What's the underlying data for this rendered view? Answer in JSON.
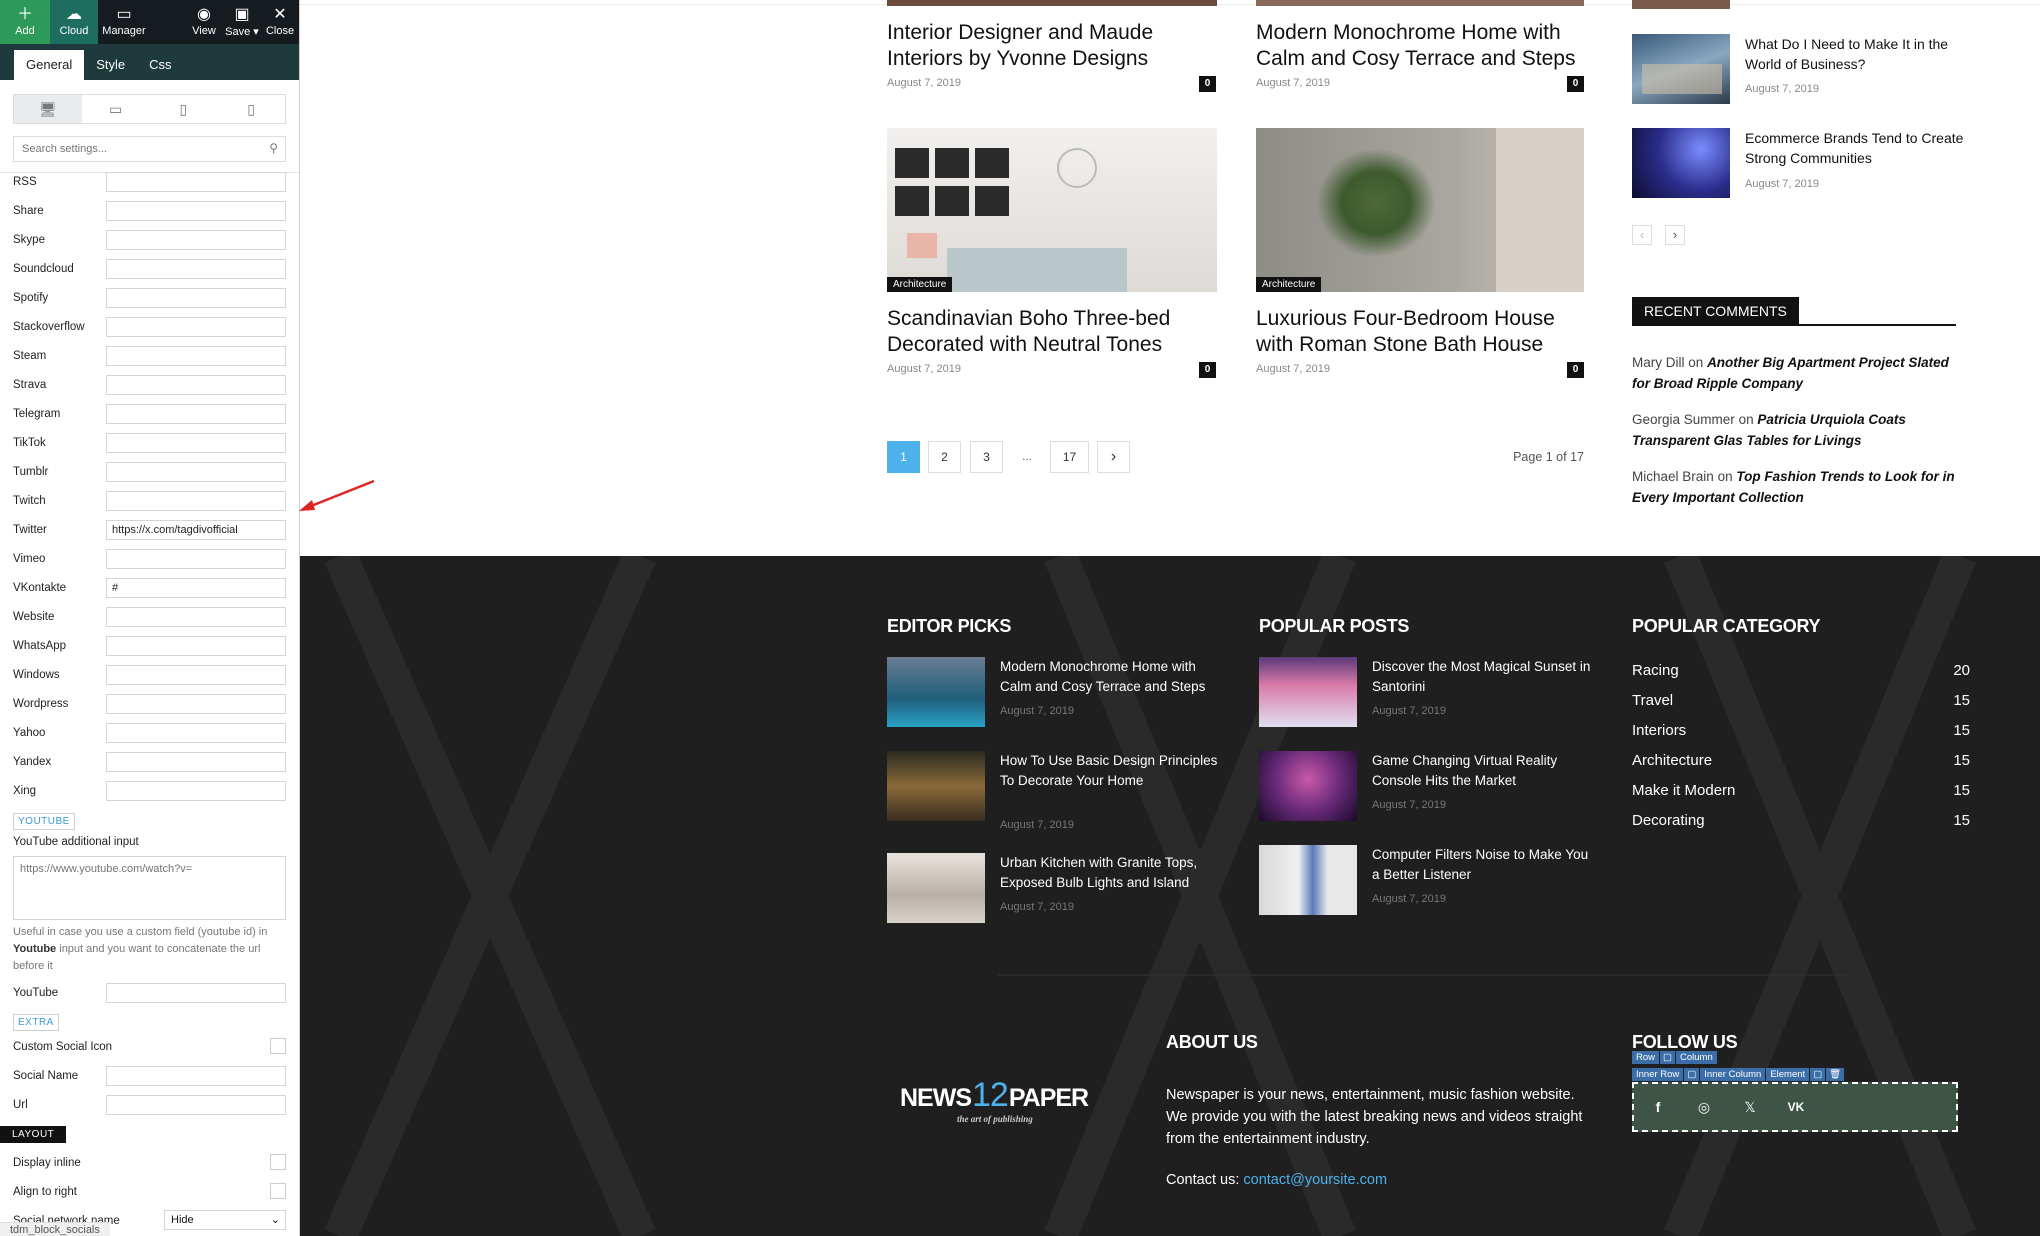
{
  "toolbar": {
    "add": "Add",
    "cloud": "Cloud",
    "manager": "Manager",
    "view": "View",
    "save": "Save",
    "close": "Close"
  },
  "tabs": [
    "General",
    "Style",
    "Css"
  ],
  "search": {
    "placeholder": "Search settings..."
  },
  "social_fields": [
    {
      "label": "RSS",
      "value": ""
    },
    {
      "label": "Share",
      "value": ""
    },
    {
      "label": "Skype",
      "value": ""
    },
    {
      "label": "Soundcloud",
      "value": ""
    },
    {
      "label": "Spotify",
      "value": ""
    },
    {
      "label": "Stackoverflow",
      "value": ""
    },
    {
      "label": "Steam",
      "value": ""
    },
    {
      "label": "Strava",
      "value": ""
    },
    {
      "label": "Telegram",
      "value": ""
    },
    {
      "label": "TikTok",
      "value": ""
    },
    {
      "label": "Tumblr",
      "value": ""
    },
    {
      "label": "Twitch",
      "value": ""
    },
    {
      "label": "Twitter",
      "value": "https://x.com/tagdivofficial"
    },
    {
      "label": "Vimeo",
      "value": ""
    },
    {
      "label": "VKontakte",
      "value": "#"
    },
    {
      "label": "Website",
      "value": ""
    },
    {
      "label": "WhatsApp",
      "value": ""
    },
    {
      "label": "Windows",
      "value": ""
    },
    {
      "label": "Wordpress",
      "value": ""
    },
    {
      "label": "Yahoo",
      "value": ""
    },
    {
      "label": "Yandex",
      "value": ""
    },
    {
      "label": "Xing",
      "value": ""
    }
  ],
  "youtube": {
    "section": "YOUTUBE",
    "additional_label": "YouTube additional input",
    "textarea_placeholder": "https://www.youtube.com/watch?v=",
    "help_pre": "Useful in case you use a custom field (youtube id) in ",
    "help_bold": "Youtube",
    "help_post": " input and you want to concatenate the url before it",
    "youtube_label": "YouTube"
  },
  "extra": {
    "section": "EXTRA",
    "custom_icon": "Custom Social Icon",
    "social_name": "Social Name",
    "url": "Url"
  },
  "layout": {
    "section": "LAYOUT",
    "display_inline": "Display inline",
    "align_right": "Align to right",
    "social_network_name": "Social network name",
    "sn_value": "Hide"
  },
  "status_bar": "tdm_block_socials",
  "articles": [
    {
      "title": "Interior Designer and Maude Interiors by Yvonne Designs",
      "date": "August 7, 2019",
      "comments": "0"
    },
    {
      "title": "Modern Monochrome Home with Calm and Cosy Terrace and Steps",
      "date": "August 7, 2019",
      "comments": "0"
    },
    {
      "title": "Scandinavian Boho Three-bed Decorated with Neutral Tones",
      "date": "August 7, 2019",
      "comments": "0",
      "category": "Architecture"
    },
    {
      "title": "Luxurious Four-Bedroom House with Roman Stone Bath House",
      "date": "August 7, 2019",
      "comments": "0",
      "category": "Architecture"
    }
  ],
  "pagination": {
    "pages": [
      "1",
      "2",
      "3",
      "...",
      "17"
    ],
    "next": "›",
    "page_info": "Page 1 of 17"
  },
  "side_posts": [
    {
      "title": "What Do I Need to Make It in the World of Business?",
      "date": "August 7, 2019"
    },
    {
      "title": "Ecommerce Brands Tend to Create Strong Communities",
      "date": "August 7, 2019"
    }
  ],
  "side_nav": {
    "prev": "‹",
    "next": "›"
  },
  "recent_comments": {
    "title": "RECENT COMMENTS",
    "items": [
      {
        "author": "Mary Dill",
        "on": "on",
        "post": "Another Big Apartment Project Slated for Broad Ripple Company"
      },
      {
        "author": "Georgia Summer",
        "on": "on",
        "post": "Patricia Urquiola Coats Transparent Glas Tables for Livings"
      },
      {
        "author": "Michael Brain",
        "on": "on",
        "post": "Top Fashion Trends to Look for in Every Important Collection"
      }
    ]
  },
  "footer": {
    "editor_picks": {
      "title": "EDITOR PICKS",
      "posts": [
        {
          "title": "Modern Monochrome Home with Calm and Cosy Terrace and Steps",
          "date": "August 7, 2019"
        },
        {
          "title": "How To Use Basic Design Principles To Decorate Your Home",
          "date": "August 7, 2019"
        },
        {
          "title": "Urban Kitchen with Granite Tops, Exposed Bulb Lights and Island",
          "date": "August 7, 2019"
        }
      ]
    },
    "popular_posts": {
      "title": "POPULAR POSTS",
      "posts": [
        {
          "title": "Discover the Most Magical Sunset in Santorini",
          "date": "August 7, 2019"
        },
        {
          "title": "Game Changing Virtual Reality Console Hits the Market",
          "date": "August 7, 2019"
        },
        {
          "title": "Computer Filters Noise to Make You a Better Listener",
          "date": "August 7, 2019"
        }
      ]
    },
    "popular_category": {
      "title": "POPULAR CATEGORY",
      "items": [
        {
          "name": "Racing",
          "count": "20"
        },
        {
          "name": "Travel",
          "count": "15"
        },
        {
          "name": "Interiors",
          "count": "15"
        },
        {
          "name": "Architecture",
          "count": "15"
        },
        {
          "name": "Make it Modern",
          "count": "15"
        },
        {
          "name": "Decorating",
          "count": "15"
        }
      ]
    },
    "about": {
      "title": "ABOUT US",
      "text": "Newspaper is your news, entertainment, music fashion website. We provide you with the latest breaking news and videos straight from the entertainment industry.",
      "contact_label": "Contact us:",
      "email": "contact@yoursite.com"
    },
    "logo": {
      "left": "NEWS",
      "num": "12",
      "right": "PAPER",
      "tagline": "the art of publishing"
    },
    "follow": {
      "title": "FOLLOW US"
    },
    "builder_tags": {
      "row": "Row",
      "column": "Column",
      "inner_row": "Inner Row",
      "inner_column": "Inner Column",
      "element": "Element"
    }
  },
  "colors": {
    "accent": "#4db2ec",
    "sidebar_dark": "#161b1f",
    "tab_bar": "#1f3a3d",
    "footer_bg": "#1f1f1f",
    "builder_blue": "#3b6ea8",
    "arrow": "#e02424"
  }
}
